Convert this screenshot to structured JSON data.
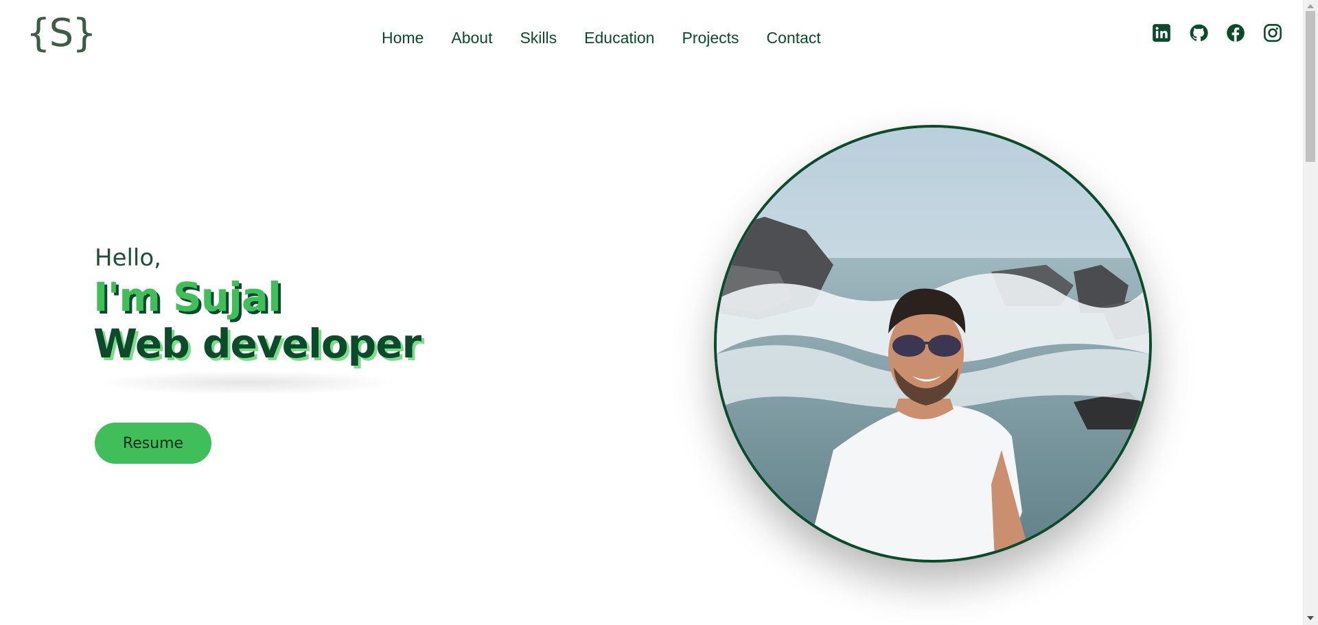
{
  "header": {
    "logo_text": "{S}",
    "nav": [
      "Home",
      "About",
      "Skills",
      "Education",
      "Projects",
      "Contact"
    ],
    "social_icons": [
      "linkedin-icon",
      "github-icon",
      "facebook-icon",
      "instagram-icon"
    ]
  },
  "hero": {
    "greeting": "Hello,",
    "name": "I'm Sujal",
    "role": "Web developer",
    "resume_label": "Resume"
  },
  "colors": {
    "primary_dark_green": "#0b4a2a",
    "accent_green": "#3fbe5a",
    "logo_gray_green": "#3e5b46",
    "background": "#ffffff"
  },
  "photo": {
    "description_icon": "profile-photo"
  }
}
